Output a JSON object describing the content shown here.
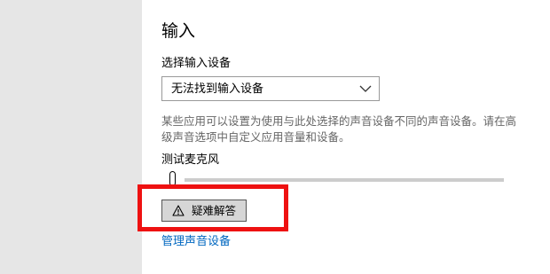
{
  "input": {
    "title": "输入",
    "select_device_label": "选择输入设备",
    "device_dropdown": {
      "selected": "无法找到输入设备",
      "icon": "chevron-down-icon"
    },
    "description": "某些应用可以设置为使用与此处选择的声音设备不同的声音设备。请在高级声音选项中自定义应用音量和设备。",
    "test_mic_label": "测试麦克风",
    "mic_level": 0,
    "troubleshoot_button": {
      "label": "疑难解答",
      "icon": "warning-icon"
    },
    "manage_devices_link": "管理声音设备"
  },
  "colors": {
    "left_pane": "#e6e6e6",
    "link": "#0067c0",
    "highlight": "#ee1111",
    "button_bg": "#d6d6d6",
    "meter_track": "#cccccc"
  }
}
